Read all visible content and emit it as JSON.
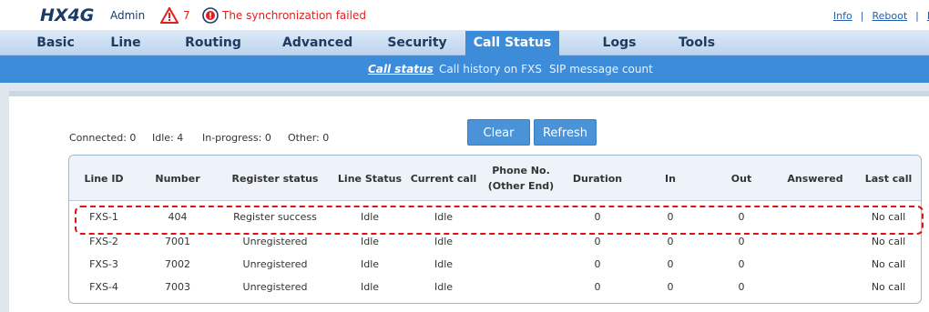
{
  "header": {
    "brand": "HX4G",
    "user": "Admin",
    "alert_count": "7",
    "sync_message": "The synchronization failed",
    "links": [
      "Info",
      "Reboot",
      "L"
    ]
  },
  "nav": {
    "items": [
      "Basic",
      "Line",
      "Routing",
      "Advanced",
      "Security",
      "Call Status",
      "Logs",
      "Tools"
    ],
    "active": "Call Status"
  },
  "subnav": {
    "items": [
      "Call status",
      "Call history on FXS",
      "SIP message count"
    ],
    "active": "Call status"
  },
  "counts": {
    "connected": "Connected: 0",
    "idle": "Idle: 4",
    "in_progress": "In-progress: 0",
    "other": "Other: 0"
  },
  "buttons": {
    "clear": "Clear",
    "refresh": "Refresh"
  },
  "table": {
    "columns": [
      "Line ID",
      "Number",
      "Register status",
      "Line Status",
      "Current call",
      "Phone No.\n(Other End)",
      "Duration",
      "In",
      "Out",
      "Answered",
      "Last call"
    ],
    "rows": [
      [
        "FXS-1",
        "404",
        "Register success",
        "Idle",
        "Idle",
        "",
        "0",
        "0",
        "0",
        "",
        "No call"
      ],
      [
        "FXS-2",
        "7001",
        "Unregistered",
        "Idle",
        "Idle",
        "",
        "0",
        "0",
        "0",
        "",
        "No call"
      ],
      [
        "FXS-3",
        "7002",
        "Unregistered",
        "Idle",
        "Idle",
        "",
        "0",
        "0",
        "0",
        "",
        "No call"
      ],
      [
        "FXS-4",
        "7003",
        "Unregistered",
        "Idle",
        "Idle",
        "",
        "0",
        "0",
        "0",
        "",
        "No call"
      ]
    ]
  },
  "colors": {
    "accent": "#3d8cd9",
    "alert": "#e02020",
    "brand": "#1a3b66"
  }
}
